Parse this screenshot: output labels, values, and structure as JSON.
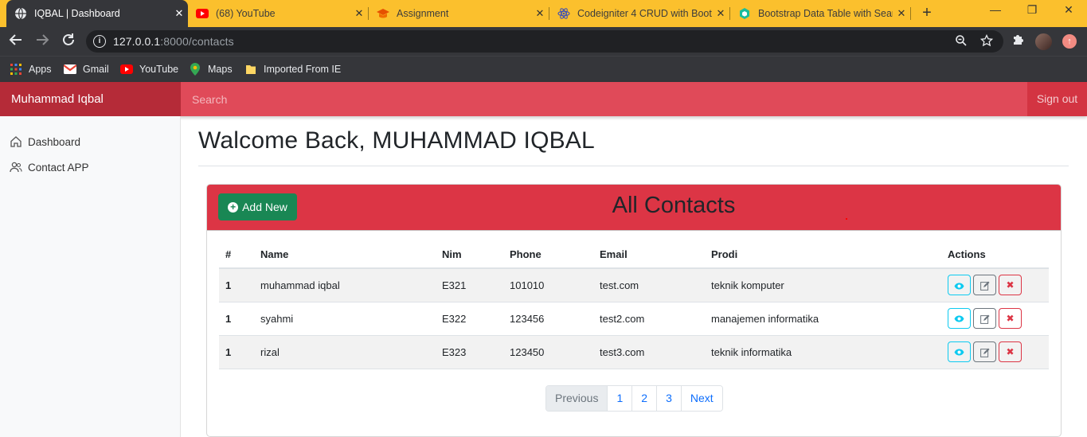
{
  "browser": {
    "tabs": [
      {
        "title": "IQBAL | Dashboard",
        "icon": "globe-icon",
        "active": true
      },
      {
        "title": "(68) YouTube",
        "icon": "youtube-icon"
      },
      {
        "title": "Assignment",
        "icon": "graduation-cap-icon"
      },
      {
        "title": "Codeigniter 4 CRUD with Boot",
        "icon": "react-icon"
      },
      {
        "title": "Bootstrap Data Table with Sear",
        "icon": "bootstrap-icon"
      }
    ],
    "url_host": "127.0.0.1",
    "url_path": ":8000/contacts",
    "bookmarks": [
      {
        "label": "Apps",
        "icon": "apps-grid-icon"
      },
      {
        "label": "Gmail",
        "icon": "gmail-icon"
      },
      {
        "label": "YouTube",
        "icon": "youtube-icon"
      },
      {
        "label": "Maps",
        "icon": "maps-pin-icon"
      },
      {
        "label": "Imported From IE",
        "icon": "folder-icon"
      }
    ]
  },
  "navbar": {
    "brand": "Muhammad Iqbal",
    "search_placeholder": "Search",
    "signout": "Sign out"
  },
  "sidebar": {
    "items": [
      {
        "label": "Dashboard",
        "icon": "home-icon"
      },
      {
        "label": "Contact APP",
        "icon": "users-icon"
      }
    ]
  },
  "main": {
    "heading": "Walcome Back, MUHAMMAD IQBAL"
  },
  "contacts": {
    "add_button": "Add New",
    "title": "All Contacts",
    "columns": [
      "#",
      "Name",
      "Nim",
      "Phone",
      "Email",
      "Prodi",
      "Actions"
    ],
    "rows": [
      {
        "num": "1",
        "name": "muhammad iqbal",
        "nim": "E321",
        "phone": "101010",
        "email": "test.com",
        "prodi": "teknik komputer"
      },
      {
        "num": "1",
        "name": "syahmi",
        "nim": "E322",
        "phone": "123456",
        "email": "test2.com",
        "prodi": "manajemen informatika"
      },
      {
        "num": "1",
        "name": "rizal",
        "nim": "E323",
        "phone": "123450",
        "email": "test3.com",
        "prodi": "teknik informatika"
      }
    ],
    "actions": {
      "view_icon": "eye-icon",
      "edit_icon": "edit-icon",
      "delete_icon": "delete-x-icon"
    },
    "pagination": {
      "previous": "Previous",
      "pages": [
        "1",
        "2",
        "3"
      ],
      "next": "Next"
    }
  },
  "colors": {
    "primary_red": "#dc3545",
    "success_green": "#198754",
    "chrome_tab_bar": "#fbc02d",
    "chrome_dark": "#35363a"
  }
}
